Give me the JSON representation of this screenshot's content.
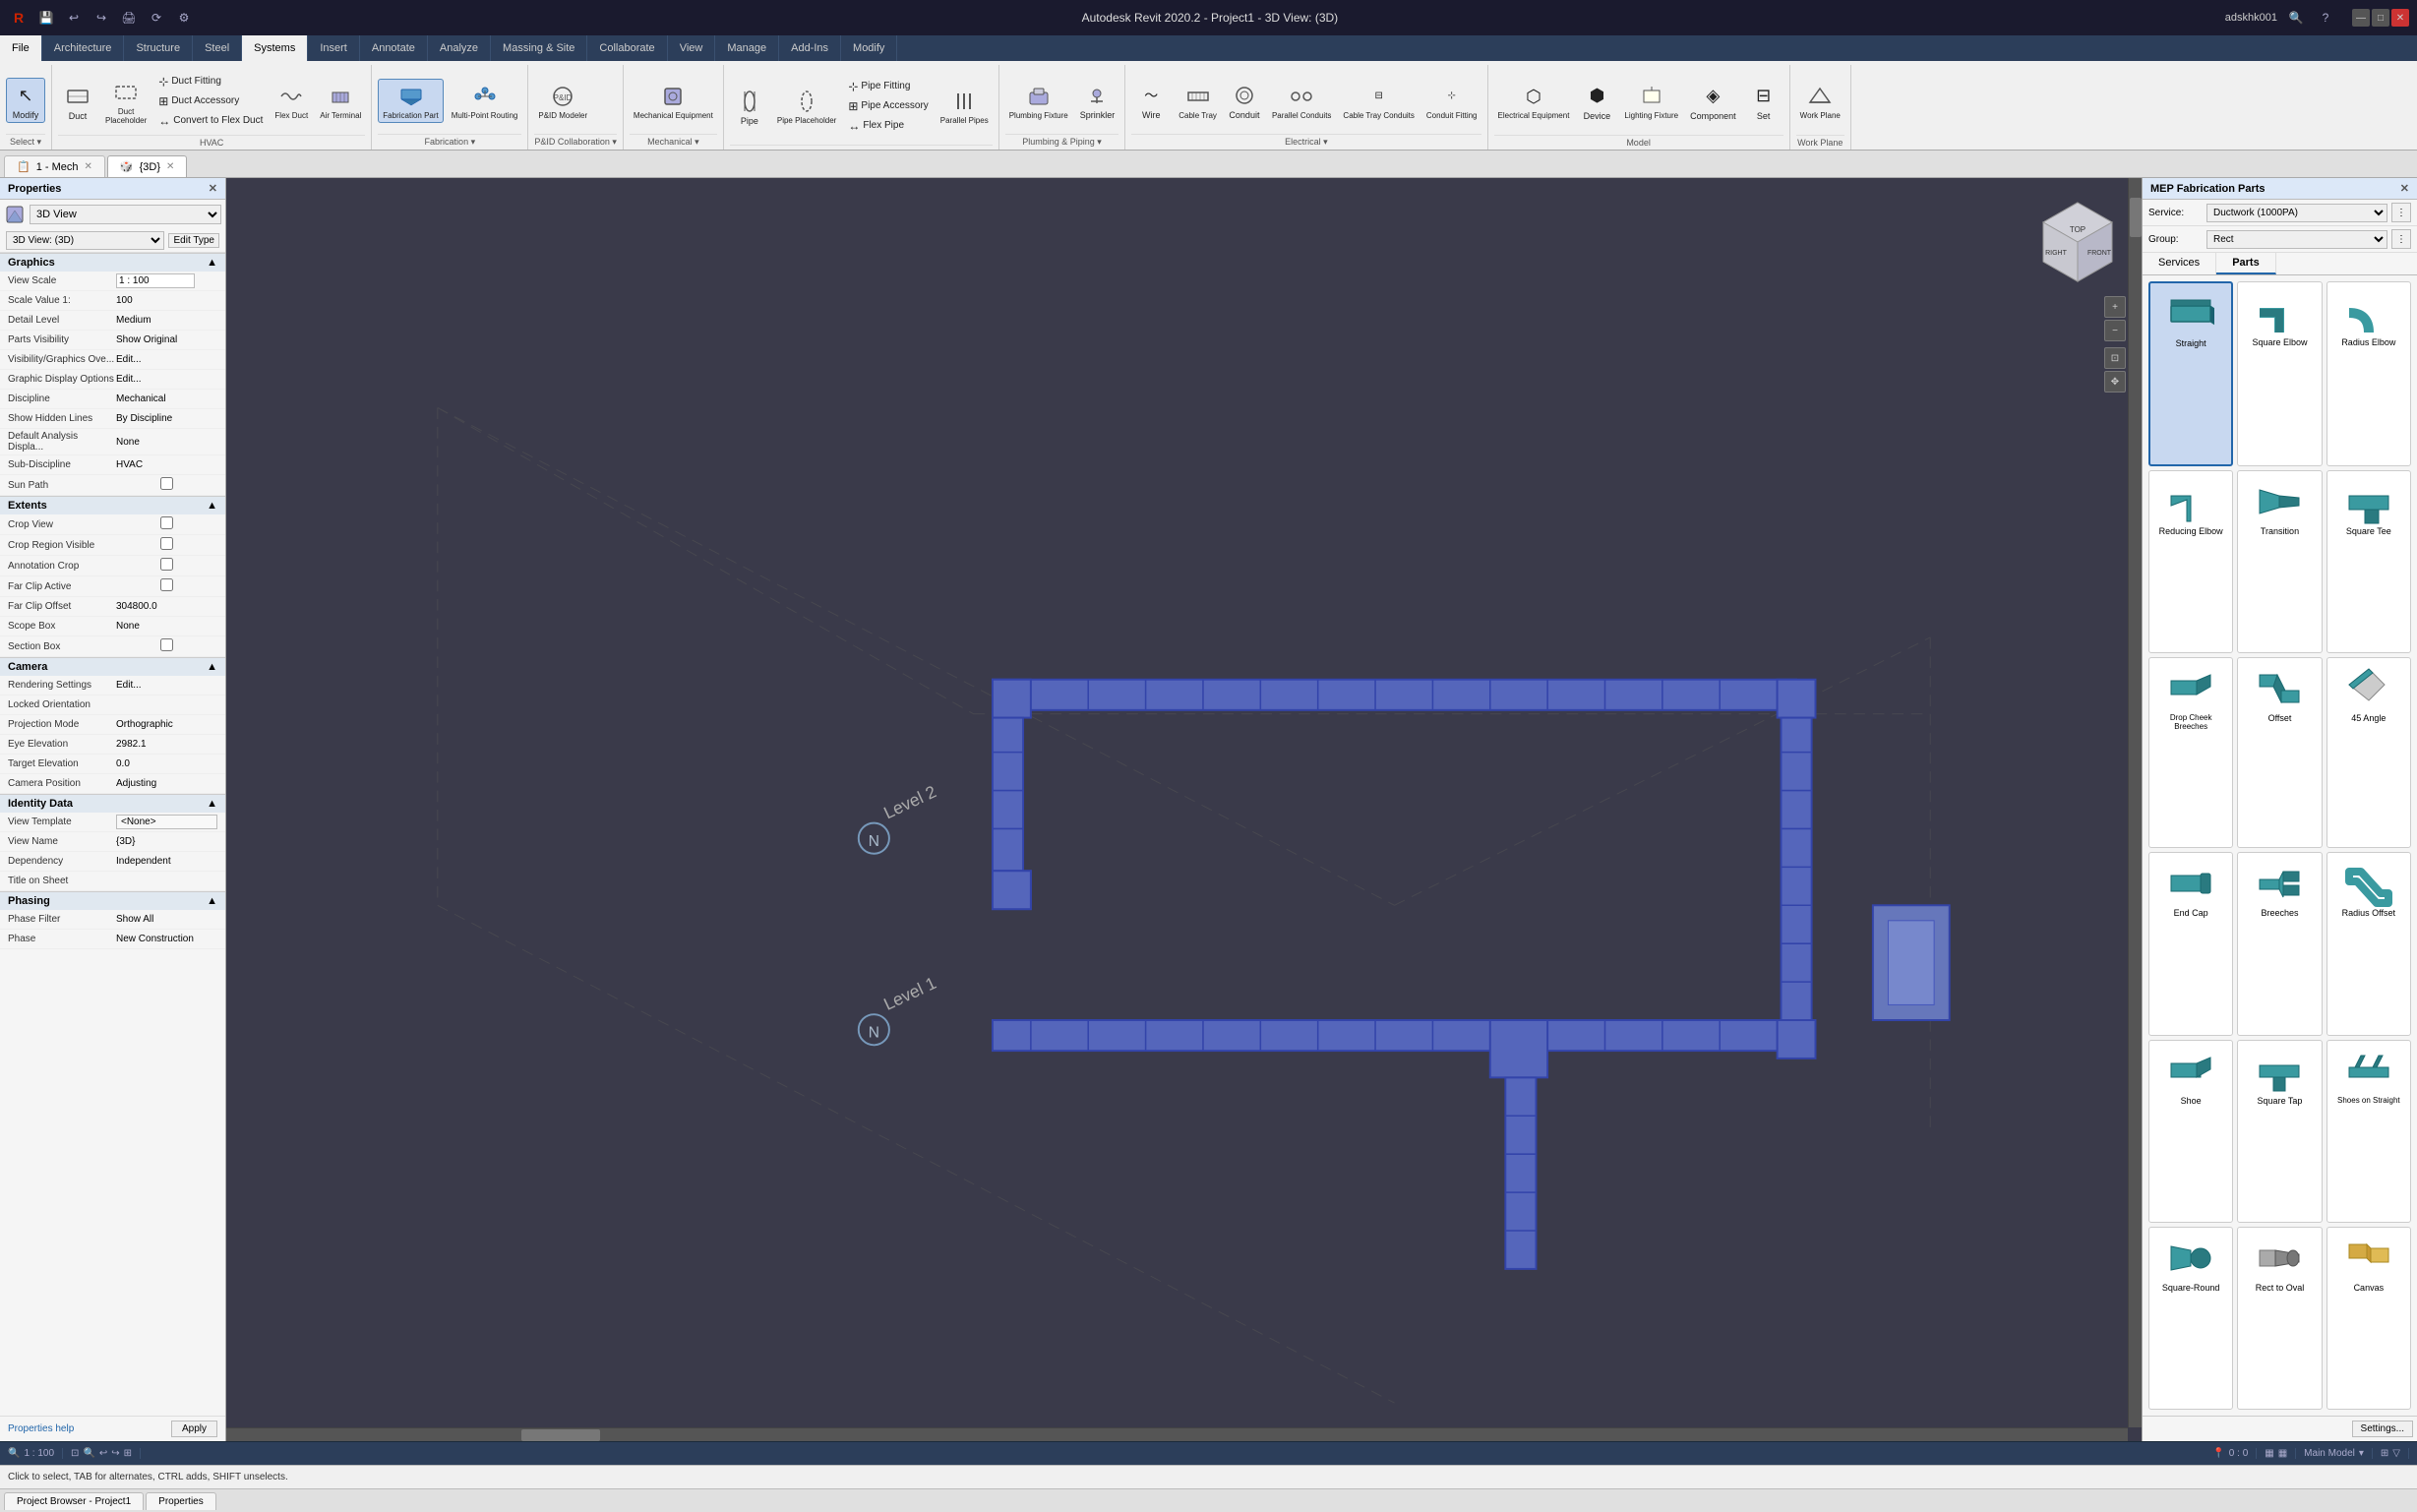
{
  "app": {
    "title": "Autodesk Revit 2020.2 - Project1 - 3D View: (3D)",
    "user": "adskhk001"
  },
  "title_bar": {
    "app_icon": "R",
    "title": "Autodesk Revit 2020.2 - Project1 - 3D View: (3D)",
    "user_label": "adskhk001",
    "help_label": "?"
  },
  "ribbon": {
    "tabs": [
      {
        "label": "File",
        "active": false
      },
      {
        "label": "Architecture",
        "active": false
      },
      {
        "label": "Structure",
        "active": false
      },
      {
        "label": "Steel",
        "active": false
      },
      {
        "label": "Systems",
        "active": true
      },
      {
        "label": "Insert",
        "active": false
      },
      {
        "label": "Annotate",
        "active": false
      },
      {
        "label": "Analyze",
        "active": false
      },
      {
        "label": "Massing & Site",
        "active": false
      },
      {
        "label": "Collaborate",
        "active": false
      },
      {
        "label": "View",
        "active": false
      },
      {
        "label": "Manage",
        "active": false
      },
      {
        "label": "Add-Ins",
        "active": false
      },
      {
        "label": "Modify",
        "active": false
      }
    ],
    "groups": {
      "select": {
        "label": "Select",
        "items": [
          {
            "icon": "⊹",
            "label": "Modify"
          }
        ]
      },
      "hvac": {
        "label": "HVAC",
        "items": [
          {
            "icon": "⬜",
            "label": "Duct"
          },
          {
            "icon": "▣",
            "label": "Duct Placeholder"
          },
          {
            "sub": [
              "Duct  Fitting",
              "Duct  Accessory",
              "Convert to  Flex Duct"
            ]
          },
          {
            "icon": "⬛",
            "label": "Flex Duct"
          },
          {
            "icon": "⬡",
            "label": "Air Terminal"
          }
        ]
      },
      "fabrication": {
        "label": "Fabrication",
        "items": [
          {
            "icon": "⬛",
            "label": "Fabrication Part",
            "active": true
          },
          {
            "icon": "◈",
            "label": "Multi-Point Routing"
          }
        ]
      },
      "paid": {
        "label": "P&ID Collaboration",
        "items": [
          {
            "icon": "◎",
            "label": "P&ID Modeler"
          }
        ]
      },
      "mechanical": {
        "label": "Mechanical",
        "items": [
          {
            "icon": "⬡",
            "label": "Mechanical Equipment"
          }
        ]
      },
      "pipe": {
        "label": "",
        "items": [
          {
            "icon": "—",
            "label": "Pipe"
          },
          {
            "icon": "⊟",
            "label": "Pipe Placeholder"
          },
          {
            "sub": [
              "Pipe Fitting",
              "Pipe Accessory",
              "Flex Pipe"
            ]
          },
          {
            "icon": "⬢",
            "label": "Parallel Pipes"
          }
        ]
      },
      "plumbing": {
        "label": "Plumbing & Piping",
        "items": [
          {
            "icon": "⬛",
            "label": "Plumbing Fixture"
          },
          {
            "icon": "💧",
            "label": "Sprinkler"
          }
        ]
      },
      "electrical": {
        "label": "Electrical",
        "items": [
          {
            "icon": "⬛",
            "label": "Wire"
          },
          {
            "icon": "⬛",
            "label": "Cable Tray"
          },
          {
            "icon": "○",
            "label": "Conduit"
          },
          {
            "icon": "⊟",
            "label": "Parallel Conduits"
          },
          {
            "icon": "⬡",
            "label": "Cable Tray Conduits"
          },
          {
            "icon": "⊹",
            "label": "Conduit Fitting"
          }
        ]
      },
      "model": {
        "label": "Model",
        "items": [
          {
            "icon": "⬡",
            "label": "Electrical Equipment"
          },
          {
            "icon": "⬢",
            "label": "Device"
          },
          {
            "icon": "⬡",
            "label": "Lighting Fixture"
          },
          {
            "icon": "◈",
            "label": "Component"
          },
          {
            "icon": "⊟",
            "label": "Set"
          }
        ]
      }
    }
  },
  "doc_tabs": [
    {
      "label": "1 - Mech",
      "active": false,
      "closeable": true
    },
    {
      "label": "{3D}",
      "active": true,
      "closeable": true
    }
  ],
  "properties": {
    "title": "Properties",
    "type": "3D View",
    "view_label": "3D View: (3D)",
    "edit_type_label": "Edit Type",
    "sections": [
      {
        "name": "Graphics",
        "rows": [
          {
            "label": "View Scale",
            "value": "1 : 100",
            "input": true
          },
          {
            "label": "Scale Value 1:",
            "value": "100"
          },
          {
            "label": "Detail Level",
            "value": "Medium"
          },
          {
            "label": "Parts Visibility",
            "value": "Show Original"
          },
          {
            "label": "Visibility/Graphics Ove...",
            "value": "Edit...",
            "link": true
          },
          {
            "label": "Graphic Display Options",
            "value": "Edit...",
            "link": true
          },
          {
            "label": "Discipline",
            "value": "Mechanical"
          },
          {
            "label": "Show Hidden Lines",
            "value": "By Discipline"
          },
          {
            "label": "Default Analysis Displa...",
            "value": "None"
          },
          {
            "label": "Sub-Discipline",
            "value": "HVAC"
          },
          {
            "label": "Sun Path",
            "value": "",
            "checkbox": true
          }
        ]
      },
      {
        "name": "Extents",
        "rows": [
          {
            "label": "Crop View",
            "value": "",
            "checkbox": true
          },
          {
            "label": "Crop Region Visible",
            "value": "",
            "checkbox": true
          },
          {
            "label": "Annotation Crop",
            "value": "",
            "checkbox": true
          },
          {
            "label": "Far Clip Active",
            "value": "",
            "checkbox": true
          },
          {
            "label": "Far Clip Offset",
            "value": "304800.0"
          },
          {
            "label": "Scope Box",
            "value": "None"
          },
          {
            "label": "Section Box",
            "value": "",
            "checkbox": true
          }
        ]
      },
      {
        "name": "Camera",
        "rows": [
          {
            "label": "Rendering Settings",
            "value": "Edit...",
            "link": true
          },
          {
            "label": "Locked Orientation",
            "value": ""
          },
          {
            "label": "Projection Mode",
            "value": "Orthographic"
          },
          {
            "label": "Eye Elevation",
            "value": "2982.1"
          },
          {
            "label": "Target Elevation",
            "value": "0.0"
          },
          {
            "label": "Camera Position",
            "value": "Adjusting"
          }
        ]
      },
      {
        "name": "Identity Data",
        "rows": [
          {
            "label": "View Template",
            "value": "<None>"
          },
          {
            "label": "View Name",
            "value": "{3D}"
          },
          {
            "label": "Dependency",
            "value": "Independent"
          },
          {
            "label": "Title on Sheet",
            "value": ""
          }
        ]
      },
      {
        "name": "Phasing",
        "rows": [
          {
            "label": "Phase Filter",
            "value": "Show All"
          },
          {
            "label": "Phase",
            "value": "New Construction"
          }
        ]
      }
    ],
    "footer": {
      "help_link": "Properties help",
      "apply_btn": "Apply"
    }
  },
  "mep_panel": {
    "title": "MEP Fabrication Parts",
    "service_label": "Service:",
    "service_value": "Ductwork (1000PA)",
    "group_label": "Group:",
    "group_value": "Rect",
    "tabs": [
      "Services",
      "Parts"
    ],
    "active_tab": "Parts",
    "parts": [
      {
        "id": "straight",
        "label": "Straight",
        "selected": true,
        "color": "#3a9aa0"
      },
      {
        "id": "square-elbow",
        "label": "Square Elbow",
        "selected": false,
        "color": "#3a9aa0"
      },
      {
        "id": "radius-elbow",
        "label": "Radius Elbow",
        "selected": false,
        "color": "#3a9aa0"
      },
      {
        "id": "reducing-elbow",
        "label": "Reducing Elbow",
        "selected": false,
        "color": "#3a9aa0"
      },
      {
        "id": "transition",
        "label": "Transition",
        "selected": false,
        "color": "#3a9aa0"
      },
      {
        "id": "square-tee",
        "label": "Square Tee",
        "selected": false,
        "color": "#3a9aa0"
      },
      {
        "id": "drop-cheek-breeches",
        "label": "Drop Cheek Breeches",
        "selected": false,
        "color": "#3a9aa0"
      },
      {
        "id": "offset",
        "label": "Offset",
        "selected": false,
        "color": "#3a9aa0"
      },
      {
        "id": "45-angle",
        "label": "45 Angle",
        "selected": false,
        "color": "#3a9aa0"
      },
      {
        "id": "end-cap",
        "label": "End Cap",
        "selected": false,
        "color": "#3a9aa0"
      },
      {
        "id": "breeches",
        "label": "Breeches",
        "selected": false,
        "color": "#3a9aa0"
      },
      {
        "id": "radius-offset",
        "label": "Radius Offset",
        "selected": false,
        "color": "#3a9aa0"
      },
      {
        "id": "shoe",
        "label": "Shoe",
        "selected": false,
        "color": "#3a9aa0"
      },
      {
        "id": "square-tap",
        "label": "Square Tap",
        "selected": false,
        "color": "#3a9aa0"
      },
      {
        "id": "shoes-on-straight",
        "label": "Shoes on Straight",
        "selected": false,
        "color": "#3a9aa0"
      },
      {
        "id": "square-round",
        "label": "Square-Round",
        "selected": false,
        "color": "#3a9aa0"
      },
      {
        "id": "rect-to-oval",
        "label": "Rect to Oval",
        "selected": false,
        "color": "#888"
      },
      {
        "id": "canvas",
        "label": "Canvas",
        "selected": false,
        "color": "#d4aa44"
      }
    ]
  },
  "status_bar": {
    "scale": "1 : 100",
    "model": "Main Model",
    "message": "Click to select, TAB for alternates, CTRL adds, SHIFT unselects."
  },
  "bottom_bar": {
    "project_browser": "Project Browser - Project1",
    "properties": "Properties"
  }
}
